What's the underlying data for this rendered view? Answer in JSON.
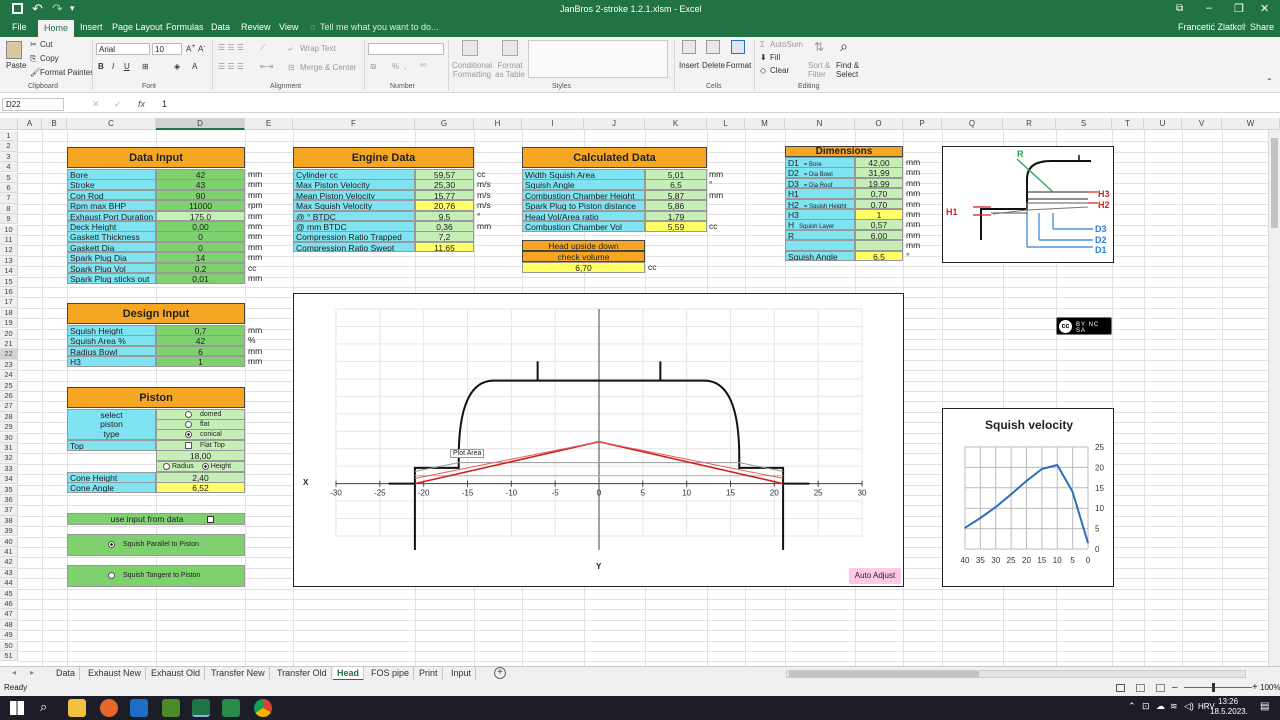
{
  "window": {
    "title": "JanBros 2-stroke 1.2.1.xlsm - Excel",
    "user": "Francetić Zlatko",
    "share": "Share"
  },
  "ribbon": {
    "tabs": [
      "File",
      "Home",
      "Insert",
      "Page Layout",
      "Formulas",
      "Data",
      "Review",
      "View"
    ],
    "tell_me": "Tell me what you want to do...",
    "clipboard": {
      "paste": "Paste",
      "cut": "Cut",
      "copy": "Copy",
      "format_painter": "Format Painter",
      "group": "Clipboard"
    },
    "font": {
      "name": "Arial",
      "size": "10",
      "group": "Font"
    },
    "alignment": {
      "wrap": "Wrap Text",
      "merge": "Merge & Center",
      "group": "Alignment"
    },
    "number": {
      "group": "Number",
      "percent": "%"
    },
    "styles": {
      "conditional": "Conditional Formatting",
      "format_table": "Format as Table",
      "group": "Styles"
    },
    "cells": {
      "insert": "Insert",
      "delete": "Delete",
      "format": "Format",
      "group": "Cells"
    },
    "editing": {
      "autosum": "AutoSum",
      "fill": "Fill",
      "clear": "Clear",
      "sort": "Sort & Filter",
      "find": "Find & Select",
      "group": "Editing"
    }
  },
  "formula_bar": {
    "name_box": "D22",
    "fx": "fx",
    "value": "1"
  },
  "columns": [
    "A",
    "B",
    "C",
    "D",
    "E",
    "F",
    "G",
    "H",
    "I",
    "J",
    "K",
    "L",
    "M",
    "N",
    "O",
    "P",
    "Q",
    "R",
    "S",
    "T",
    "U",
    "V",
    "W"
  ],
  "rows": [
    "1",
    "2",
    "3",
    "4",
    "5",
    "6",
    "7",
    "8",
    "9",
    "10",
    "11",
    "12",
    "13",
    "14",
    "15",
    "16",
    "17",
    "18",
    "19",
    "20",
    "21",
    "22",
    "23",
    "24",
    "25",
    "26",
    "27",
    "28",
    "29",
    "30",
    "31",
    "32",
    "33",
    "34",
    "35",
    "36",
    "37",
    "38",
    "39",
    "40",
    "41",
    "42",
    "43",
    "44",
    "45",
    "46",
    "47",
    "48",
    "49",
    "50",
    "51"
  ],
  "data_input": {
    "title": "Data Input",
    "rows": [
      {
        "label": "Bore",
        "value": "42",
        "unit": "mm"
      },
      {
        "label": "Stroke",
        "value": "43",
        "unit": "mm"
      },
      {
        "label": "Con  Rod",
        "value": "90",
        "unit": "mm"
      },
      {
        "label": "Rpm max BHP",
        "value": "11000",
        "unit": "rpm"
      },
      {
        "label": "Exhaust Port Duration",
        "value": "175,0",
        "unit": "mm"
      },
      {
        "label": "Deck  Height",
        "value": "0,00",
        "unit": "mm"
      },
      {
        "label": "Gaskett  Thickness",
        "value": "0",
        "unit": "mm"
      },
      {
        "label": "Gaskett  Dia",
        "value": "0",
        "unit": "mm"
      },
      {
        "label": "Spark  Plug  Dia",
        "value": "14",
        "unit": "mm"
      },
      {
        "label": "Spark  Plug  Vol",
        "value": "0,2",
        "unit": "cc"
      },
      {
        "label": "Spark Plug sticks out",
        "value": "0,01",
        "unit": "mm"
      }
    ]
  },
  "engine_data": {
    "title": "Engine Data",
    "rows": [
      {
        "label": "Cylinder  cc",
        "value": "59,57",
        "unit": "cc"
      },
      {
        "label": "Max  Piston  Velocity",
        "value": "25,30",
        "unit": "m/s"
      },
      {
        "label": "Mean  Piston  Velocity",
        "value": "15,77",
        "unit": "m/s"
      },
      {
        "label": "Max  Squish Velocity",
        "value": "20,76",
        "unit": "m/s"
      },
      {
        "label": "@    °    BTDC",
        "value": "9,5",
        "unit": "°"
      },
      {
        "label": "@    mm BTDC",
        "value": "0,36",
        "unit": "mm"
      },
      {
        "label": "Compression  Ratio  Trapped",
        "value": "7,2",
        "unit": ""
      },
      {
        "label": "Compression  Ratio  Swept",
        "value": "11,65",
        "unit": ""
      }
    ]
  },
  "calculated_data": {
    "title": "Calculated Data",
    "rows": [
      {
        "label": "Width  Squish  Area",
        "value": "5,01",
        "unit": "mm"
      },
      {
        "label": "Squish  Angle",
        "value": "6,5",
        "unit": "°"
      },
      {
        "label": "Combustion  Chamber  Height",
        "value": "5,87",
        "unit": "mm"
      },
      {
        "label": "Spark Plug to Piston distance",
        "value": "5,86",
        "unit": ""
      },
      {
        "label": "Head  Vol/Area  ratio",
        "value": "1,79",
        "unit": ""
      },
      {
        "label": "Combustion  Chamber  Vol",
        "value": "5,59",
        "unit": "cc"
      }
    ],
    "check_title_1": "Head upside down",
    "check_title_2": "check volume",
    "check_value": "6,70",
    "check_unit": "cc"
  },
  "dimensions": {
    "title": "Dimensions",
    "rows": [
      {
        "label": "D1",
        "note": "= Bore",
        "value": "42,00",
        "unit": "mm"
      },
      {
        "label": "D2",
        "note": "= Dia Bowl",
        "value": "31,99",
        "unit": "mm"
      },
      {
        "label": "D3",
        "note": "= Dia Roof",
        "value": "19,99",
        "unit": "mm"
      },
      {
        "label": "H1",
        "note": "",
        "value": "0,70",
        "unit": "mm"
      },
      {
        "label": "H2",
        "note": "= Squish Height",
        "value": "0,70",
        "unit": "mm"
      },
      {
        "label": "H3",
        "note": "",
        "value": "1",
        "unit": "mm"
      },
      {
        "label": "H",
        "note": "Squish Layer",
        "value": "0,57",
        "unit": "mm"
      },
      {
        "label": "R",
        "note": "",
        "value": "6,00",
        "unit": "mm"
      },
      {
        "label": "",
        "note": "",
        "value": "",
        "unit": "mm"
      },
      {
        "label": "Squish Angle",
        "note": "",
        "value": "6,5",
        "unit": "°"
      }
    ]
  },
  "design_input": {
    "title": "Design Input",
    "rows": [
      {
        "label": "Squish  Height",
        "value": "0,7",
        "unit": "mm"
      },
      {
        "label": "Squish  Area   %",
        "value": "42",
        "unit": "%"
      },
      {
        "label": "Radius  Bowl",
        "value": "6",
        "unit": "mm"
      },
      {
        "label": "H3",
        "value": "1",
        "unit": "mm"
      }
    ]
  },
  "piston": {
    "title": "Piston",
    "select_1": "select",
    "select_2": "piston",
    "select_3": "type",
    "opt_domed": "domed",
    "opt_flat": "flat",
    "opt_conical": "conical",
    "top_label": "Top",
    "flat_top": "Flat Top",
    "top_value": "18,00",
    "radius": "Radius",
    "height": "Height",
    "cone_height_label": "Cone Height",
    "cone_height": "2,40",
    "cone_angle_label": "Cone Angle",
    "cone_angle": "6,52"
  },
  "use_input": "use input from data",
  "squish_parallel": "Squish Parallel to Piston",
  "squish_tangent": "Squish Tangent to Piston",
  "diagram_labels": {
    "R": "R",
    "H1": "H1",
    "H2": "H2",
    "H3": "H3",
    "D1": "D1",
    "D2": "D2",
    "D3": "D3"
  },
  "license_badge": "BY NC SA",
  "plot": {
    "plot_area_tooltip": "Plot Area",
    "x_label": "X",
    "y_label": "Y",
    "auto_adjust": "Auto Adjust",
    "x_ticks": [
      "-30",
      "-25",
      "-20",
      "-15",
      "-10",
      "-5",
      "0",
      "5",
      "10",
      "15",
      "20",
      "25",
      "30"
    ]
  },
  "chart_data": {
    "type": "line",
    "title": "Squish velocity",
    "x": [
      40,
      35,
      30,
      25,
      20,
      15,
      10,
      5,
      0
    ],
    "series": [
      {
        "values": [
          5.2,
          7.6,
          10.3,
          13.4,
          16.7,
          19.6,
          20.6,
          14,
          1.5
        ]
      }
    ],
    "x_ticks": [
      "40",
      "35",
      "30",
      "25",
      "20",
      "15",
      "10",
      "5",
      "0"
    ],
    "y_ticks": [
      "25",
      "20",
      "15",
      "10",
      "5",
      "0"
    ],
    "xlim": [
      40,
      0
    ],
    "ylim": [
      0,
      25
    ],
    "color": "#2e6fbd",
    "grid": true
  },
  "sheet_tabs": [
    "Data",
    "Exhaust New",
    "Exhaust Old",
    "Transfer New",
    "Transfer Old",
    "Head",
    "FOS pipe",
    "Print",
    "Input"
  ],
  "active_tab": "Head",
  "status": {
    "ready": "Ready",
    "zoom": "100%"
  },
  "taskbar": {
    "lang": "HRV",
    "time": "13:26",
    "date": "18.5.2023."
  }
}
